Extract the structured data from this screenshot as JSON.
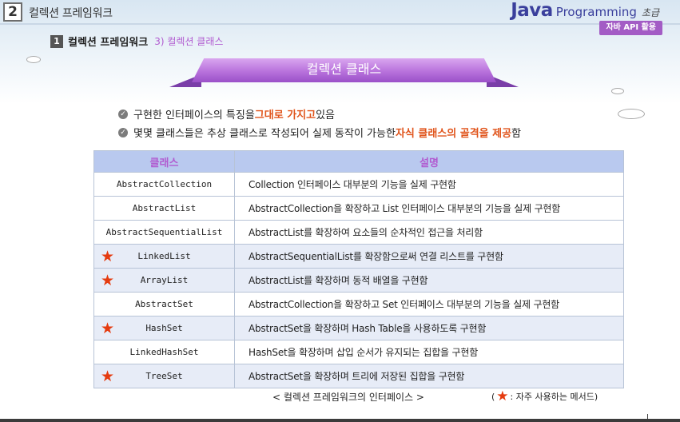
{
  "header": {
    "chapter_number": "2",
    "chapter_title": "컬렉션 프레임워크",
    "brand_java": "Java",
    "brand_programming": "Programming",
    "brand_level": "초급",
    "tag": "자바 API 활용"
  },
  "subheader": {
    "number": "1",
    "title": "컬렉션 프레임워크",
    "section": "3) 컬렉션 클래스"
  },
  "banner": {
    "title": "컬렉션 클래스"
  },
  "bullets": [
    {
      "pre": "구현한 인터페이스의 특징을 ",
      "hl": "그대로 가지고",
      "post": " 있음"
    },
    {
      "pre": "몇몇 클래스들은 추상 클래스로 작성되어 실제 동작이 가능한 ",
      "hl": "자식 클래스의 골격을 제공",
      "post": "함"
    }
  ],
  "table": {
    "headers": [
      "클래스",
      "설명"
    ],
    "rows": [
      {
        "name": "AbstractCollection",
        "desc": "Collection 인터페이스 대부분의 기능을 실제 구현함",
        "star": false
      },
      {
        "name": "AbstractList",
        "desc": "AbstractCollection을 확장하고 List 인터페이스 대부분의 기능을 실제 구현함",
        "star": false
      },
      {
        "name": "AbstractSequentialList",
        "desc": "AbstractList를 확장하여 요소들의 순차적인 접근을 처리함",
        "star": false
      },
      {
        "name": "LinkedList",
        "desc": "AbstractSequentialList를 확장함으로써 연결 리스트를 구현함",
        "star": true
      },
      {
        "name": "ArrayList",
        "desc": "AbstractList를 확장하며 동적 배열을 구현함",
        "star": true
      },
      {
        "name": "AbstractSet",
        "desc": "AbstractCollection을 확장하고 Set 인터페이스 대부분의 기능을 실제 구현함",
        "star": false
      },
      {
        "name": "HashSet",
        "desc": "AbstractSet을 확장하며 Hash Table을 사용하도록 구현함",
        "star": true
      },
      {
        "name": "LinkedHashSet",
        "desc": "HashSet을 확장하며 삽입 순서가 유지되는 집합을 구현함",
        "star": false
      },
      {
        "name": "TreeSet",
        "desc": "AbstractSet을 확장하며 트리에 저장된 집합을 구현함",
        "star": true
      }
    ]
  },
  "caption": "< 컬렉션 프레임워크의 인터페이스 >",
  "legend": {
    "open": "(",
    "text": ": 자주 사용하는 메서드)"
  },
  "colors": {
    "accent_purple": "#b15bd0",
    "highlight_orange": "#e0541b",
    "star_red": "#e53b0f",
    "table_header_bg": "#b9c9ef"
  }
}
